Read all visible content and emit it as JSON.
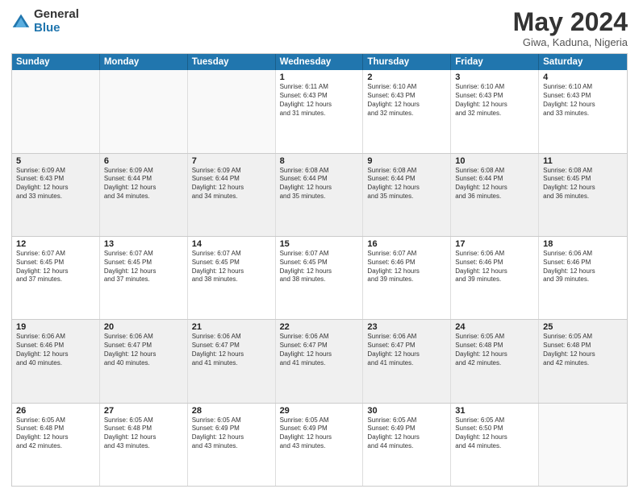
{
  "logo": {
    "general": "General",
    "blue": "Blue"
  },
  "title": "May 2024",
  "subtitle": "Giwa, Kaduna, Nigeria",
  "header_days": [
    "Sunday",
    "Monday",
    "Tuesday",
    "Wednesday",
    "Thursday",
    "Friday",
    "Saturday"
  ],
  "weeks": [
    [
      {
        "day": "",
        "info": ""
      },
      {
        "day": "",
        "info": ""
      },
      {
        "day": "",
        "info": ""
      },
      {
        "day": "1",
        "info": "Sunrise: 6:11 AM\nSunset: 6:43 PM\nDaylight: 12 hours\nand 31 minutes."
      },
      {
        "day": "2",
        "info": "Sunrise: 6:10 AM\nSunset: 6:43 PM\nDaylight: 12 hours\nand 32 minutes."
      },
      {
        "day": "3",
        "info": "Sunrise: 6:10 AM\nSunset: 6:43 PM\nDaylight: 12 hours\nand 32 minutes."
      },
      {
        "day": "4",
        "info": "Sunrise: 6:10 AM\nSunset: 6:43 PM\nDaylight: 12 hours\nand 33 minutes."
      }
    ],
    [
      {
        "day": "5",
        "info": "Sunrise: 6:09 AM\nSunset: 6:43 PM\nDaylight: 12 hours\nand 33 minutes."
      },
      {
        "day": "6",
        "info": "Sunrise: 6:09 AM\nSunset: 6:44 PM\nDaylight: 12 hours\nand 34 minutes."
      },
      {
        "day": "7",
        "info": "Sunrise: 6:09 AM\nSunset: 6:44 PM\nDaylight: 12 hours\nand 34 minutes."
      },
      {
        "day": "8",
        "info": "Sunrise: 6:08 AM\nSunset: 6:44 PM\nDaylight: 12 hours\nand 35 minutes."
      },
      {
        "day": "9",
        "info": "Sunrise: 6:08 AM\nSunset: 6:44 PM\nDaylight: 12 hours\nand 35 minutes."
      },
      {
        "day": "10",
        "info": "Sunrise: 6:08 AM\nSunset: 6:44 PM\nDaylight: 12 hours\nand 36 minutes."
      },
      {
        "day": "11",
        "info": "Sunrise: 6:08 AM\nSunset: 6:45 PM\nDaylight: 12 hours\nand 36 minutes."
      }
    ],
    [
      {
        "day": "12",
        "info": "Sunrise: 6:07 AM\nSunset: 6:45 PM\nDaylight: 12 hours\nand 37 minutes."
      },
      {
        "day": "13",
        "info": "Sunrise: 6:07 AM\nSunset: 6:45 PM\nDaylight: 12 hours\nand 37 minutes."
      },
      {
        "day": "14",
        "info": "Sunrise: 6:07 AM\nSunset: 6:45 PM\nDaylight: 12 hours\nand 38 minutes."
      },
      {
        "day": "15",
        "info": "Sunrise: 6:07 AM\nSunset: 6:45 PM\nDaylight: 12 hours\nand 38 minutes."
      },
      {
        "day": "16",
        "info": "Sunrise: 6:07 AM\nSunset: 6:46 PM\nDaylight: 12 hours\nand 39 minutes."
      },
      {
        "day": "17",
        "info": "Sunrise: 6:06 AM\nSunset: 6:46 PM\nDaylight: 12 hours\nand 39 minutes."
      },
      {
        "day": "18",
        "info": "Sunrise: 6:06 AM\nSunset: 6:46 PM\nDaylight: 12 hours\nand 39 minutes."
      }
    ],
    [
      {
        "day": "19",
        "info": "Sunrise: 6:06 AM\nSunset: 6:46 PM\nDaylight: 12 hours\nand 40 minutes."
      },
      {
        "day": "20",
        "info": "Sunrise: 6:06 AM\nSunset: 6:47 PM\nDaylight: 12 hours\nand 40 minutes."
      },
      {
        "day": "21",
        "info": "Sunrise: 6:06 AM\nSunset: 6:47 PM\nDaylight: 12 hours\nand 41 minutes."
      },
      {
        "day": "22",
        "info": "Sunrise: 6:06 AM\nSunset: 6:47 PM\nDaylight: 12 hours\nand 41 minutes."
      },
      {
        "day": "23",
        "info": "Sunrise: 6:06 AM\nSunset: 6:47 PM\nDaylight: 12 hours\nand 41 minutes."
      },
      {
        "day": "24",
        "info": "Sunrise: 6:05 AM\nSunset: 6:48 PM\nDaylight: 12 hours\nand 42 minutes."
      },
      {
        "day": "25",
        "info": "Sunrise: 6:05 AM\nSunset: 6:48 PM\nDaylight: 12 hours\nand 42 minutes."
      }
    ],
    [
      {
        "day": "26",
        "info": "Sunrise: 6:05 AM\nSunset: 6:48 PM\nDaylight: 12 hours\nand 42 minutes."
      },
      {
        "day": "27",
        "info": "Sunrise: 6:05 AM\nSunset: 6:48 PM\nDaylight: 12 hours\nand 43 minutes."
      },
      {
        "day": "28",
        "info": "Sunrise: 6:05 AM\nSunset: 6:49 PM\nDaylight: 12 hours\nand 43 minutes."
      },
      {
        "day": "29",
        "info": "Sunrise: 6:05 AM\nSunset: 6:49 PM\nDaylight: 12 hours\nand 43 minutes."
      },
      {
        "day": "30",
        "info": "Sunrise: 6:05 AM\nSunset: 6:49 PM\nDaylight: 12 hours\nand 44 minutes."
      },
      {
        "day": "31",
        "info": "Sunrise: 6:05 AM\nSunset: 6:50 PM\nDaylight: 12 hours\nand 44 minutes."
      },
      {
        "day": "",
        "info": ""
      }
    ]
  ]
}
